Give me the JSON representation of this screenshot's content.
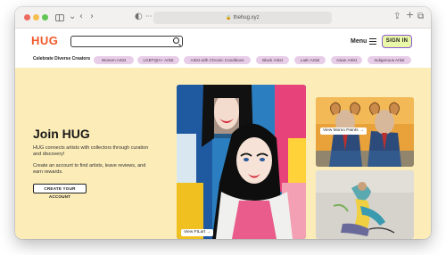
{
  "browser": {
    "url": "thehug.xyz"
  },
  "header": {
    "logo": "HUG",
    "search_placeholder": "",
    "menu_label": "Menu",
    "signin_label": "SIGN IN"
  },
  "filters": {
    "label": "Celebrate Diverse Creators",
    "chips": [
      "Women Artist",
      "LGBTQIA+ Artist",
      "Artist with Chronic Conditions",
      "Black Artist",
      "Latin Artist",
      "Asian Artist",
      "Indigenous Artist"
    ]
  },
  "hero": {
    "title": "Join HUG",
    "description": "HUG connects artists with collectors through curation and discovery!",
    "description2": "Create an account to find artists, leave reviews, and earn rewards.",
    "cta_label": "CREATE YOUR ACCOUNT"
  },
  "gallery": {
    "main_cta": "View FILart",
    "rams_cta": "View Momo Paints"
  },
  "colors": {
    "accent_logo": "#f05a28",
    "hero_bg": "#fcecb8",
    "chip_bg": "#e8cde8",
    "signin_bg": "#e8f7a8",
    "signin_border": "#8a5acf"
  }
}
